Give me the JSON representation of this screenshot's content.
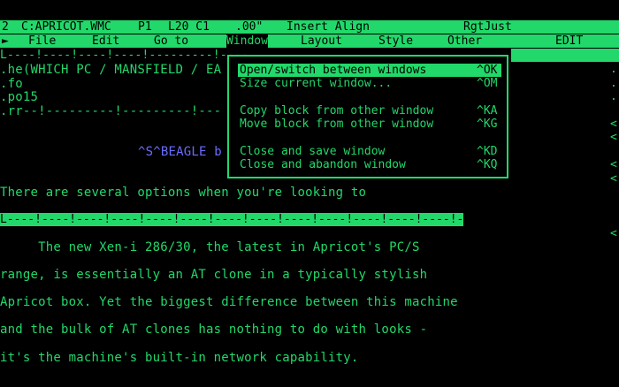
{
  "status": {
    "line": "2",
    "file": "C:APRICOT.WMC",
    "page": "P1",
    "line_col": "L20 C1",
    "position": ".00\"",
    "mode": "Insert Align",
    "justify": "RgtJust"
  },
  "menu": {
    "pointer": "►",
    "items": [
      {
        "label": "File"
      },
      {
        "label": "Edit"
      },
      {
        "label": "Go to"
      },
      {
        "label": "Window"
      },
      {
        "label": "Layout"
      },
      {
        "label": "Style"
      },
      {
        "label": "Other"
      }
    ],
    "edit_label": "EDIT"
  },
  "ruler_top": "L----!----!----!----!---------!----",
  "ruler_mid": "L----!----!----!----!----!----!----!----!----!----!----!----!----!---------------R",
  "doc_top": {
    "lines": [
      ".he(WHICH PC / MANSFIELD / EA",
      ".fo",
      ".po15",
      ".rr--!---------!---------!---"
    ],
    "beagle_line": "^S^BEAGLE b",
    "options_line": "There are several options when you're looking to"
  },
  "doc_bottom": {
    "lines": [
      "     The new Xen-i 286/30, the latest in Apricot's PC/S",
      "range, is essentially an AT clone in a typically stylish",
      "Apricot box. Yet the biggest difference between this machine",
      "and the bulk of AT clones has nothing to do with looks -",
      "it's the machine's built-in network capability."
    ]
  },
  "dropdown": {
    "items": [
      {
        "label": "Open/switch between windows",
        "key": "^OK"
      },
      {
        "label": "Size current window...",
        "key": "^OM"
      },
      {
        "label": "Copy block from other window",
        "key": "^KA"
      },
      {
        "label": "Move block from other window",
        "key": "^KG"
      },
      {
        "label": "Close and save window",
        "key": "^KD"
      },
      {
        "label": "Close and abandon window",
        "key": "^KQ"
      }
    ]
  },
  "right_marks": [
    ".",
    ".",
    ".",
    "<",
    "<",
    "<",
    "<",
    "<"
  ],
  "colors": {
    "fg": "#22d86a",
    "bg": "#000000",
    "accent": "#6a6cff"
  }
}
